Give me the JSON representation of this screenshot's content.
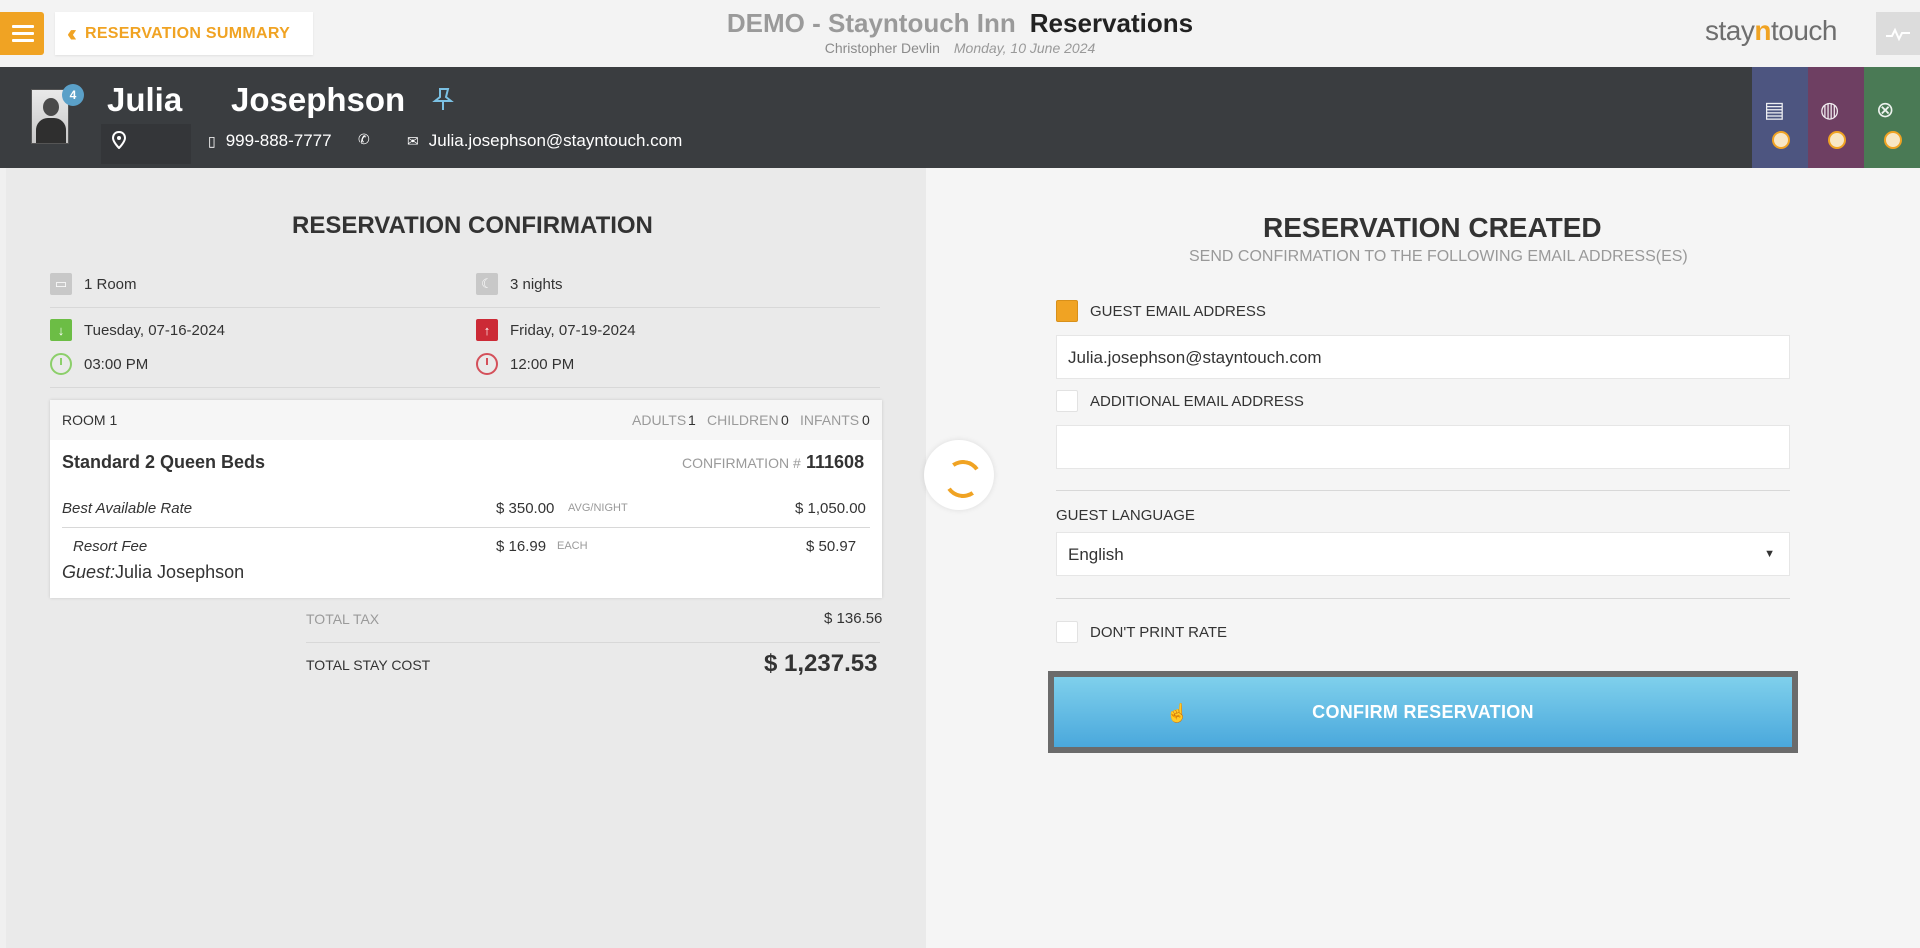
{
  "topbar": {
    "back_label": "RESERVATION SUMMARY",
    "hotel_name": "DEMO - Stayntouch Inn",
    "module_title": "Reservations",
    "user_name": "Christopher Devlin",
    "business_date": "Monday, 10 June 2024",
    "brand_prefix": "stay",
    "brand_middle": "n",
    "brand_suffix": "touch",
    "icons": {
      "menu": "hamburger-icon",
      "back": "double-chevron-left-icon",
      "corner": "activity-icon"
    }
  },
  "guest": {
    "first_name": "Julia",
    "last_name": "Josephson",
    "badge_count": "4",
    "phone": "999-888-7777",
    "email": "Julia.josephson@stayntouch.com",
    "icons": {
      "pin": "pin-icon",
      "location": "location-icon",
      "mobile": "mobile-icon",
      "phone": "phone-icon",
      "email": "envelope-icon"
    },
    "tab_icons": [
      "building-icon",
      "globe-icon",
      "group-icon"
    ],
    "tab_colors": [
      "#4d5580",
      "#6e3f62",
      "#4a7a55"
    ]
  },
  "confirmation": {
    "title": "RESERVATION CONFIRMATION",
    "rooms": "1 Room",
    "nights": "3 nights",
    "arrival_date": "Tuesday, 07-16-2024",
    "departure_date": "Friday, 07-19-2024",
    "arrival_time": "03:00 PM",
    "departure_time": "12:00 PM",
    "room": {
      "label": "ROOM 1",
      "adults_label": "ADULTS",
      "adults": "1",
      "children_label": "CHILDREN",
      "children": "0",
      "infants_label": "INFANTS",
      "infants": "0",
      "room_type": "Standard 2 Queen Beds",
      "confirmation_label": "CONFIRMATION #",
      "confirmation_number": "111608",
      "rate_name": "Best Available Rate",
      "rate_amount": "$ 350.00",
      "rate_unit": "AVG/NIGHT",
      "rate_total": "$ 1,050.00",
      "fee_name": "Resort Fee",
      "fee_amount": "$ 16.99",
      "fee_unit": "EACH",
      "fee_total": "$ 50.97",
      "guest_label": "Guest:",
      "guest_name": "Julia Josephson"
    },
    "total_tax_label": "TOTAL TAX",
    "total_tax": "$ 136.56",
    "total_stay_label": "TOTAL STAY COST",
    "total_stay": "$ 1,237.53"
  },
  "created": {
    "title": "RESERVATION CREATED",
    "subtitle": "SEND CONFIRMATION TO THE FOLLOWING EMAIL ADDRESS(ES)",
    "guest_email_label": "GUEST EMAIL ADDRESS",
    "guest_email_checked": true,
    "guest_email_value": "Julia.josephson@stayntouch.com",
    "additional_email_label": "ADDITIONAL EMAIL ADDRESS",
    "additional_email_checked": false,
    "additional_email_value": "",
    "language_label": "GUEST LANGUAGE",
    "language_value": "English",
    "dont_print_label": "DON'T PRINT RATE",
    "dont_print_checked": false,
    "confirm_label": "CONFIRM RESERVATION"
  },
  "colors": {
    "accent": "#f0a323",
    "header_dark": "#3a3d40",
    "button_blue": "#5bb7e3",
    "arrival_green": "#6cbd45",
    "departure_red": "#cc2a36"
  }
}
